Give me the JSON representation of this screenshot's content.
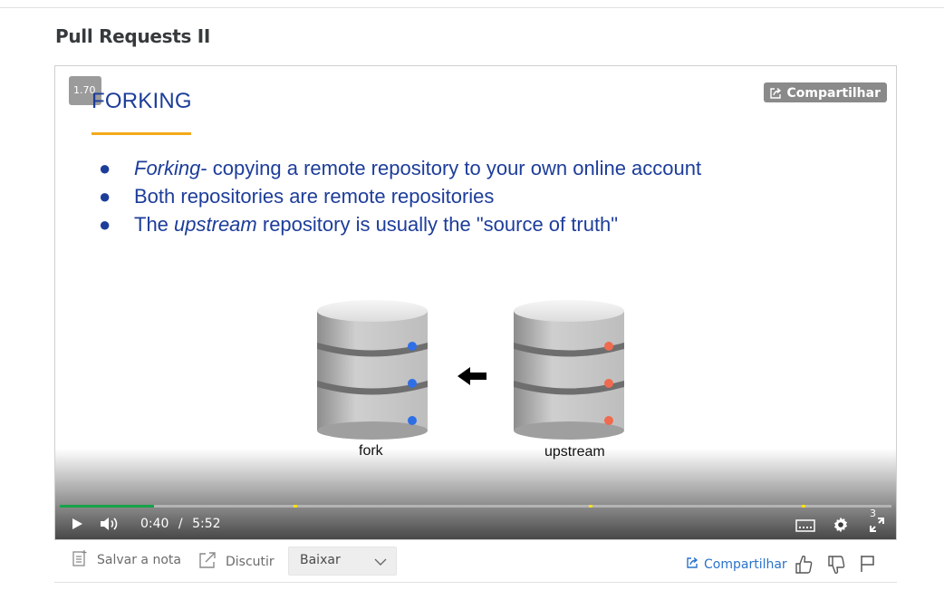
{
  "page": {
    "title": "Pull Requests II"
  },
  "player": {
    "speed": "1.70",
    "share_overlay_label": "Compartilhar",
    "slide": {
      "title": "FORKING",
      "bullets": [
        {
          "em": "Forking",
          "text": "- copying a remote repository to your own online account"
        },
        {
          "pre": "Both repositories are remote repositories"
        },
        {
          "pre": "The ",
          "em": "upstream",
          "text": " repository is usually the \"source of truth\""
        }
      ],
      "diagram": {
        "left_label": "fork",
        "right_label": "upstream",
        "left_dot_color": "#2f6fe6",
        "right_dot_color": "#f06a4f"
      }
    },
    "controls": {
      "current_time": "0:40",
      "separator": "/",
      "duration": "5:52",
      "progress_fraction": 0.1136,
      "markers_fraction": [
        0.281,
        0.636,
        0.892
      ],
      "captions_count": "3",
      "accent": "#16a34a",
      "marker_color": "#f7e01b"
    }
  },
  "toolbar": {
    "save_note_label": "Salvar a nota",
    "discuss_label": "Discutir",
    "download_select_value": "Baixar",
    "share_label": "Compartilhar",
    "link_color": "#2a73cc"
  }
}
